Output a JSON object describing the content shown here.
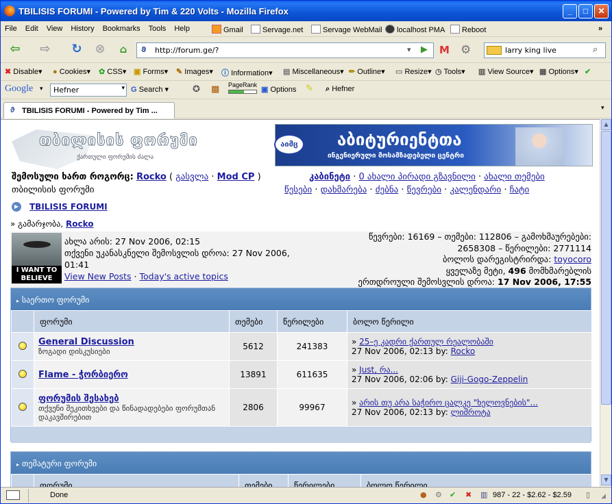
{
  "window": {
    "title": "TBILISIS FORUMI - Powered by Tim & 220 Volts - Mozilla Firefox"
  },
  "menubar": {
    "items": [
      "File",
      "Edit",
      "View",
      "History",
      "Bookmarks",
      "Tools",
      "Help"
    ],
    "bookmarks": [
      "Gmail",
      "Servage.net",
      "Servage WebMail",
      "localhost PMA",
      "Reboot"
    ],
    "overflow": "»"
  },
  "navbar": {
    "url": "http://forum.ge/?",
    "search_value": "larry king live"
  },
  "webdev_toolbar": {
    "items": [
      "Disable▾",
      "Cookies▾",
      "CSS▾",
      "Forms▾",
      "Images▾",
      "Information▾",
      "Miscellaneous▾",
      "Outline▾",
      "Resize▾",
      "Tools▾",
      "View Source▾",
      "Options▾"
    ]
  },
  "google_toolbar": {
    "brand": "Google",
    "query": "Hefner",
    "search_label": "Search",
    "pagerank_label": "PageRank",
    "options_label": "Options",
    "highlight_term": "Hefner"
  },
  "tab": {
    "label": "TBILISIS FORUMI - Powered by Tim ..."
  },
  "page": {
    "logo_title": "თბილისის ფორუმი",
    "logo_subtitle": "ქართული ფორუმის ძალა",
    "banner_title": "აბიტურიენტთა",
    "banner_subtitle": "ინგენიერული მოსამზადებელი ცენტრი",
    "banner_badge": "აიმც",
    "login_prefix": "შემოსული ხართ როგორც:",
    "login_user": "Rocko",
    "logout_link": "გასვლა",
    "modcp_link": "Mod CP",
    "paren_open": "(",
    "paren_close": ")",
    "top_links": [
      "კაბინეტი",
      "0 ახალი პირადი გზავნილი",
      "ახალი თემები"
    ],
    "site_name_link": "თბილისის ფორუმი",
    "nav_links": [
      "წესები",
      "დახმარება",
      "ძებნა",
      "წევრები",
      "კალენდარი",
      "ჩატი"
    ],
    "breadcrumb": "TBILISIS FORUMI",
    "greeting_prefix": "» გამარჯობა,",
    "greeting_user": "Rocko",
    "ufo_caption": "I WANT TO BELIEVE",
    "now_text": "ახლა არის: 27 Nov 2006, 02:15",
    "last_visit_text": "თქვენი უკანასკნელი შემოსვლის დროა: 27 Nov 2006, 01:41",
    "view_new_posts": "View New Posts",
    "todays_topics": "Today's active topics",
    "stats_line1": "წევრები: 16169 – თემები: 112806 – გამოხმაურებები:",
    "stats_line2": "2658308 – წერილები: 2771114",
    "newest_member_label": "ბოლოს დარეგისტრირდა:",
    "newest_member": "toyocoro",
    "max_online_prefix": "ყველაზე მეტი,",
    "max_online_count": "496",
    "max_online_suffix": "მომხმარებლის",
    "max_online_when_label": "ერთდროული შემოსვლის დროა:",
    "max_online_when": "17 Nov 2006, 17:55"
  },
  "category1": {
    "title": "საერთო ფორუმი",
    "headers": [
      "",
      "ფორუმი",
      "თემები",
      "წერილები",
      "ბოლო წერილი"
    ],
    "rows": [
      {
        "name": "General Discussion",
        "desc": "ზოგადი დისკუსიები",
        "topics": "5612",
        "posts": "241383",
        "last_title": "25–ე კადრი ქართულ რეალობაში",
        "last_date": "27 Nov 2006, 02:13 by:",
        "last_user": "Rocko"
      },
      {
        "name": "Flame - ჭორბიერო",
        "desc": "",
        "topics": "13891",
        "posts": "611635",
        "last_title": "Just, რა...",
        "last_date": "27 Nov 2006, 02:06 by:",
        "last_user": "Giji-Gogo-Zeppelin"
      },
      {
        "name": "ფორუმის შესახებ",
        "desc": "თქვენი შეკითხვები და წინადადებები ფორუმთან დაკავშირებით",
        "topics": "2806",
        "posts": "99967",
        "last_title": "არის თუ არა საჭირო ცალკე \"ხელოვნების\"...",
        "last_date": "27 Nov 2006, 02:13 by:",
        "last_user": "ლიშროტა"
      }
    ]
  },
  "category2": {
    "title": "თემატური ფორუმი",
    "headers": [
      "",
      "ფორუმი",
      "თემები",
      "წერილები",
      "ბოლო წერილი"
    ]
  },
  "statusbar": {
    "text": "Done",
    "stocks": "987 - 22 - $2.62 - $2.59"
  }
}
